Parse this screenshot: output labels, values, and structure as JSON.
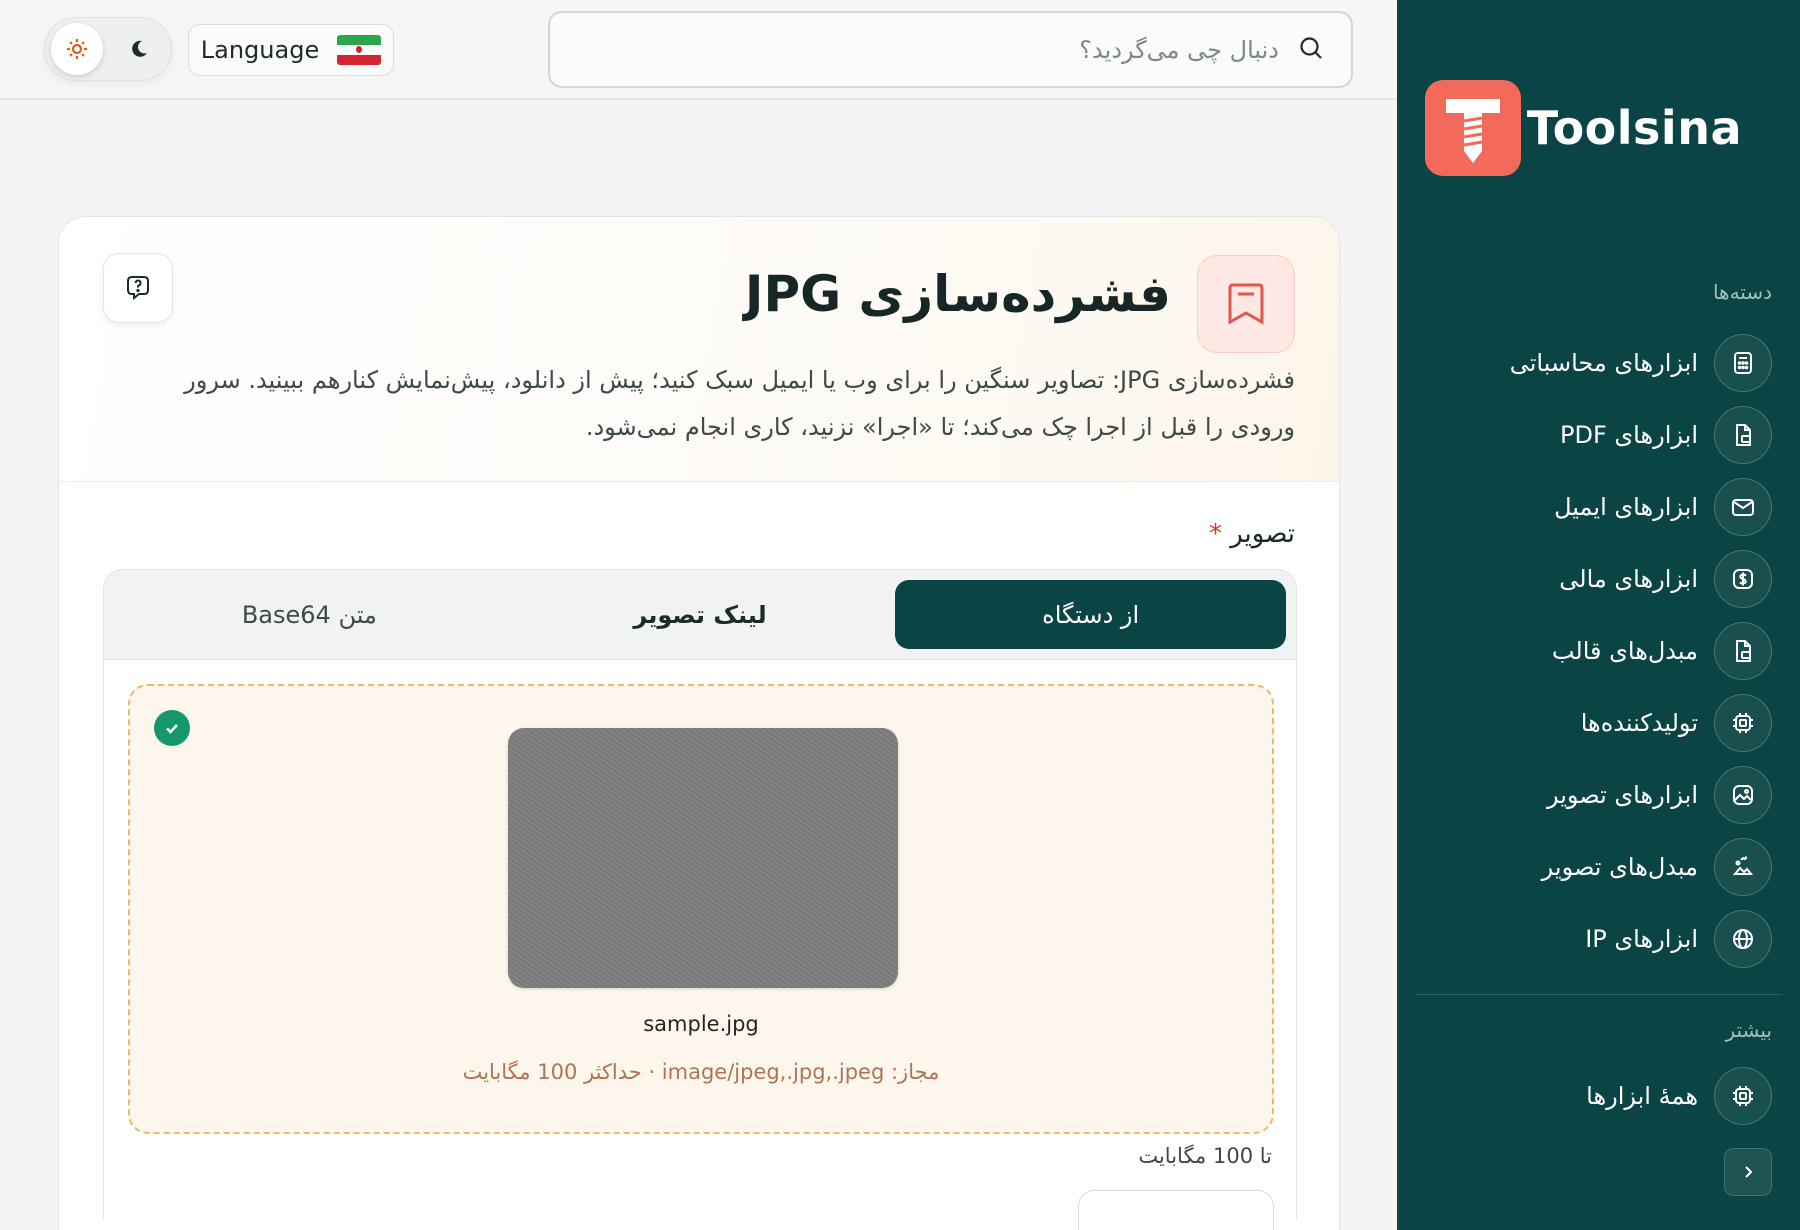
{
  "brand": {
    "name": "Toolsina"
  },
  "sidebar": {
    "categories_title": "دسته‌ها",
    "items": [
      {
        "label": "ابزارهای محاسباتی",
        "icon": "calculator-icon"
      },
      {
        "label": "ابزارهای PDF",
        "icon": "pdf-file-icon"
      },
      {
        "label": "ابزارهای ایمیل",
        "icon": "mail-icon"
      },
      {
        "label": "ابزارهای مالی",
        "icon": "dollar-icon"
      },
      {
        "label": "مبدل‌های قالب",
        "icon": "file-convert-icon"
      },
      {
        "label": "تولیدکننده‌ها",
        "icon": "chip-icon"
      },
      {
        "label": "ابزارهای تصویر",
        "icon": "image-icon"
      },
      {
        "label": "مبدل‌های تصویر",
        "icon": "image-convert-icon"
      },
      {
        "label": "ابزارهای IP",
        "icon": "globe-icon"
      }
    ],
    "more_title": "بیشتر",
    "more_items": [
      {
        "label": "همهٔ ابزارها",
        "icon": "chip-icon"
      }
    ]
  },
  "header": {
    "search_placeholder": "دنبال چی می‌گردید؟",
    "language_label": "Language"
  },
  "tool": {
    "title": "فشرده‌سازی JPG",
    "description": "فشرده‌سازی JPG: تصاویر سنگین را برای وب یا ایمیل سبک کنید؛ پیش از دانلود، پیش‌نمایش کنارهم ببینید. سرور ورودی را قبل از اجرا چک می‌کند؛ تا «اجرا» نزنید، کاری انجام نمی‌شود.",
    "field_label": "تصویر",
    "required_mark": "*",
    "tabs": [
      "از دستگاه",
      "لینک تصویر",
      "متن Base64"
    ],
    "active_tab": 0,
    "file_name": "sample.jpg",
    "allowed_text": "مجاز: image/jpeg,.jpg,.jpeg · حداکثر 100 مگابایت",
    "size_note": "تا 100 مگابایت"
  },
  "colors": {
    "sidebar_bg": "#0b4445",
    "accent_coral": "#f36a5a",
    "success": "#14976b",
    "dropzone_border": "#f2b76a"
  }
}
